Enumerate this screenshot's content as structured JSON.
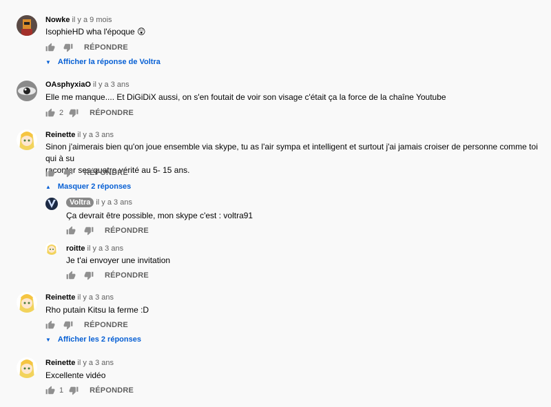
{
  "comments": [
    {
      "author": "Nowke",
      "time": "il y a 9 mois",
      "text": "IsophieHD wha l'époque 😲",
      "likes": "",
      "reply_label": "RÉPONDRE",
      "toggle": "Afficher la réponse de Voltra"
    },
    {
      "author": "OAsphyxiaO",
      "time": "il y a 3 ans",
      "text": "Elle me manque.... Et DiGiDiX aussi, on s'en foutait de voir son visage c'était ça la force de la chaîne Youtube",
      "likes": "2",
      "reply_label": "RÉPONDRE"
    },
    {
      "author": "Reinette",
      "time": "il y a 3 ans",
      "text_line1": "Sinon j'aimerais bien qu'on joue ensemble via skype, tu as l'air sympa et intelligent et surtout j'ai jamais croiser de personne comme toi qui à su",
      "text_line2": "raconter ses quatre vérité au 5- 15 ans.",
      "likes": "",
      "reply_label": "RÉPONDRE",
      "toggle": "Masquer 2 réponses"
    },
    {
      "author": "Reinette",
      "time": "il y a 3 ans",
      "text": "Rho putain Kitsu la ferme :D",
      "likes": "",
      "reply_label": "RÉPONDRE",
      "toggle": "Afficher les 2 réponses"
    },
    {
      "author": "Reinette",
      "time": "il y a 3 ans",
      "text": "Excellente vidéo",
      "likes": "1",
      "reply_label": "RÉPONDRE"
    }
  ],
  "replies": [
    {
      "author": "Voltra",
      "time": "il y a 3 ans",
      "text": "Ça devrait être possible, mon skype c'est : voltra91",
      "reply_label": "RÉPONDRE"
    },
    {
      "author": "roitte",
      "time": "il y a 3 ans",
      "text": "Je t'ai envoyer une invitation",
      "reply_label": "RÉPONDRE"
    }
  ],
  "icons": {
    "like": "thumbs-up-icon",
    "dislike": "thumbs-down-icon",
    "expand": "chevron-down-icon",
    "collapse": "chevron-up-icon"
  },
  "colors": {
    "link": "#065fd4",
    "muted": "#606060",
    "background": "#f9f9f9"
  }
}
